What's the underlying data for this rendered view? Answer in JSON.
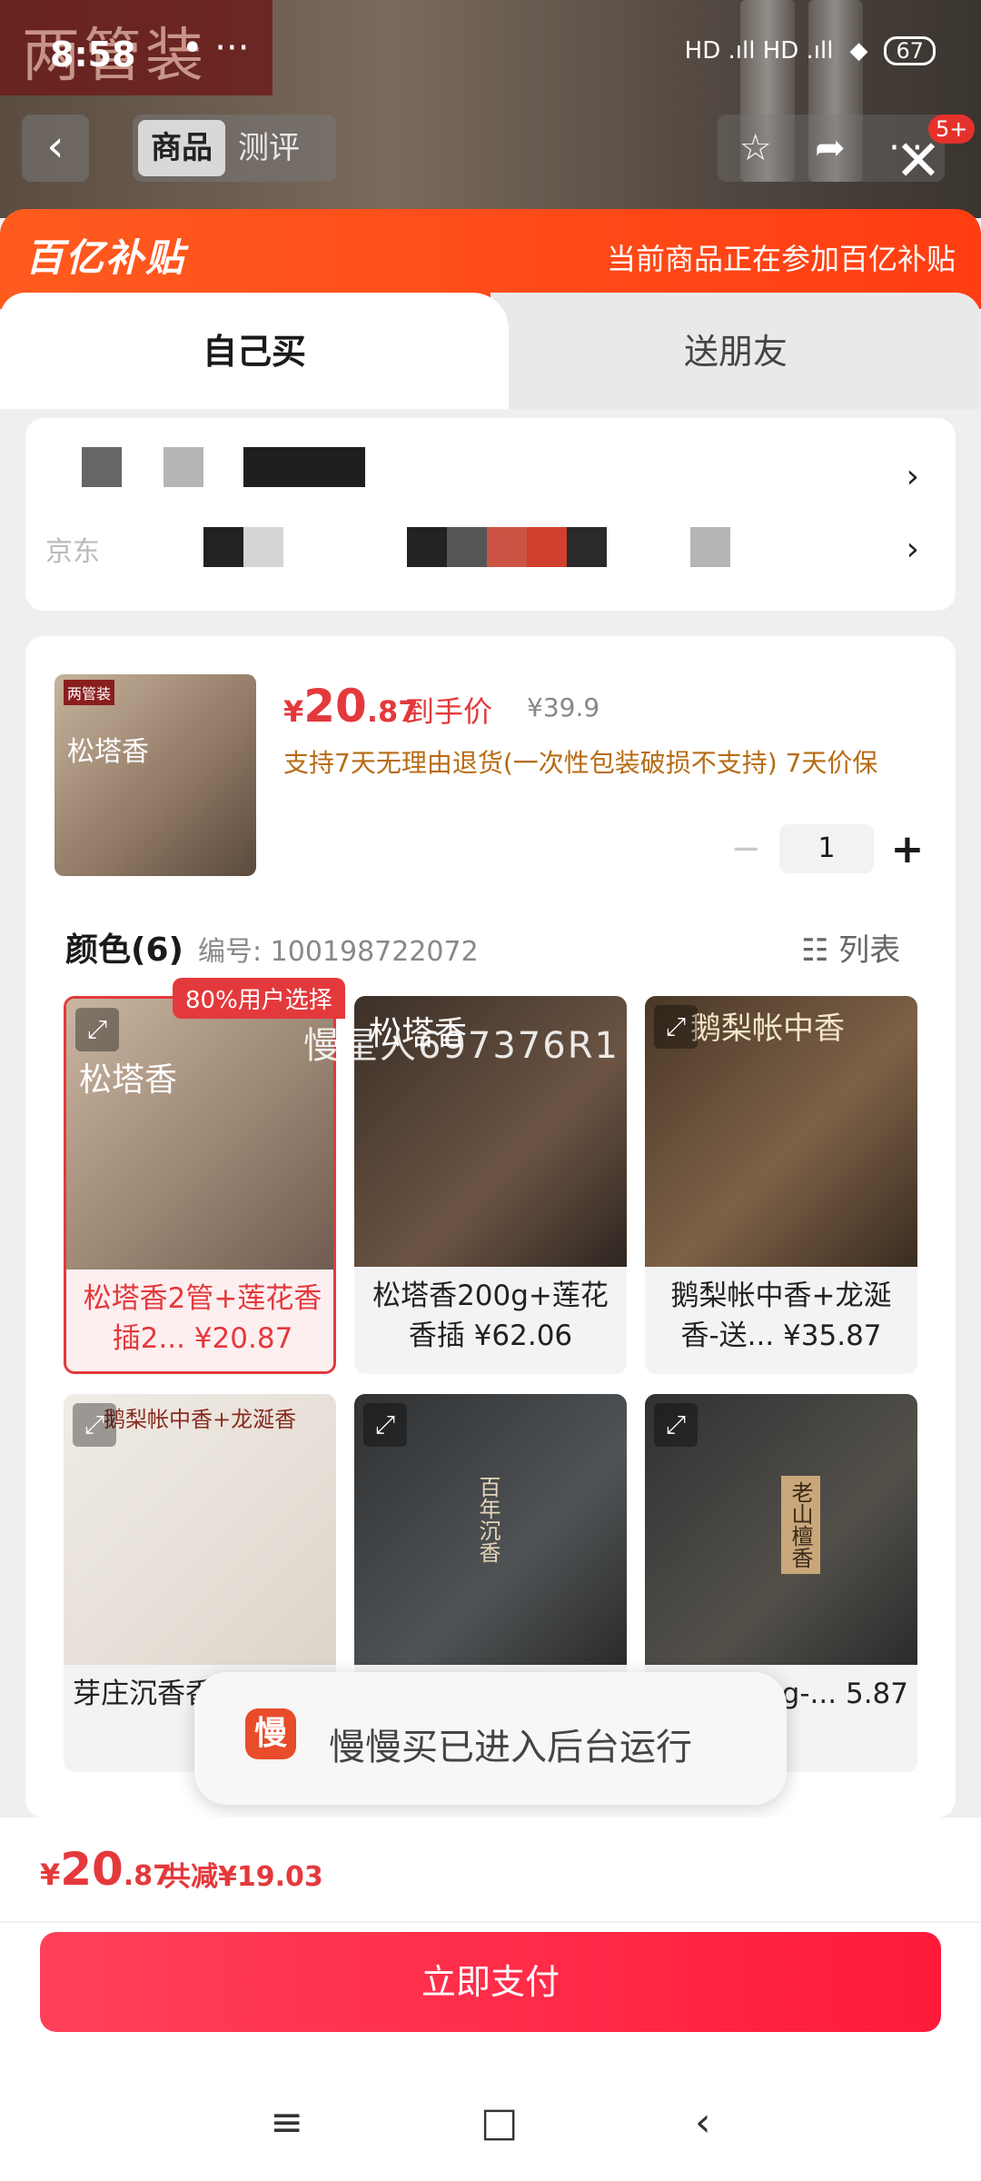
{
  "status_bar": {
    "time": "8:58",
    "dots": "•  ···",
    "signal": "HD .ıll HD .ıll",
    "battery": "67"
  },
  "top_nav": {
    "back": "‹",
    "segments": [
      "商品",
      "测评"
    ],
    "badge": "5+",
    "close": "✕"
  },
  "subsidy": {
    "brand": "百亿补贴",
    "message": "当前商品正在参加百亿补贴"
  },
  "tabs": {
    "self": "自己买",
    "friend": "送朋友"
  },
  "address": {
    "arrow": "›",
    "partial_text": "京东"
  },
  "product": {
    "price_symbol": "¥",
    "price_int": "20",
    "price_dec": ".87",
    "price_label": "到手价",
    "original_price": "¥39.9",
    "promise": "支持7天无理由退货(一次性包装破损不支持) 7天价保",
    "quantity": "1",
    "minus": "−",
    "plus": "+"
  },
  "colors": {
    "heading": "颜色(6)",
    "code": "编号: 100198722072",
    "list_view": "列表",
    "badge": "80%用户选择",
    "watermark": "慢星人697376R1",
    "items": [
      {
        "caption": "松塔香2管+莲花香插2... ¥20.87",
        "image_text": "松塔香",
        "selected": true
      },
      {
        "caption": "松塔香200g+莲花香插 ¥62.06",
        "image_text": "松塔香"
      },
      {
        "caption": "鹅梨帐中香+龙涎香-送... ¥35.87",
        "image_text": "鹅梨帐中香"
      },
      {
        "caption": "芽庄沉香香-送...",
        "image_text": "鹅梨帐中香+龙涎香"
      },
      {
        "caption": "",
        "image_text": "百年沉香"
      },
      {
        "caption": "200g-... 5.87",
        "image_text": "老山檀香"
      }
    ]
  },
  "toast": {
    "icon": "慢",
    "text": "慢慢买已进入后台运行"
  },
  "footer": {
    "price_symbol": "¥",
    "price_int": "20",
    "price_dec": ".87",
    "savings": "共减¥19.03",
    "pay_button": "立即支付"
  },
  "system_nav": {
    "menu": "≡",
    "home": "□",
    "back": "‹"
  },
  "colors_theme": {
    "accent": "#e4393c",
    "subsidy": "#ff4a17",
    "promise": "#b76b14"
  }
}
